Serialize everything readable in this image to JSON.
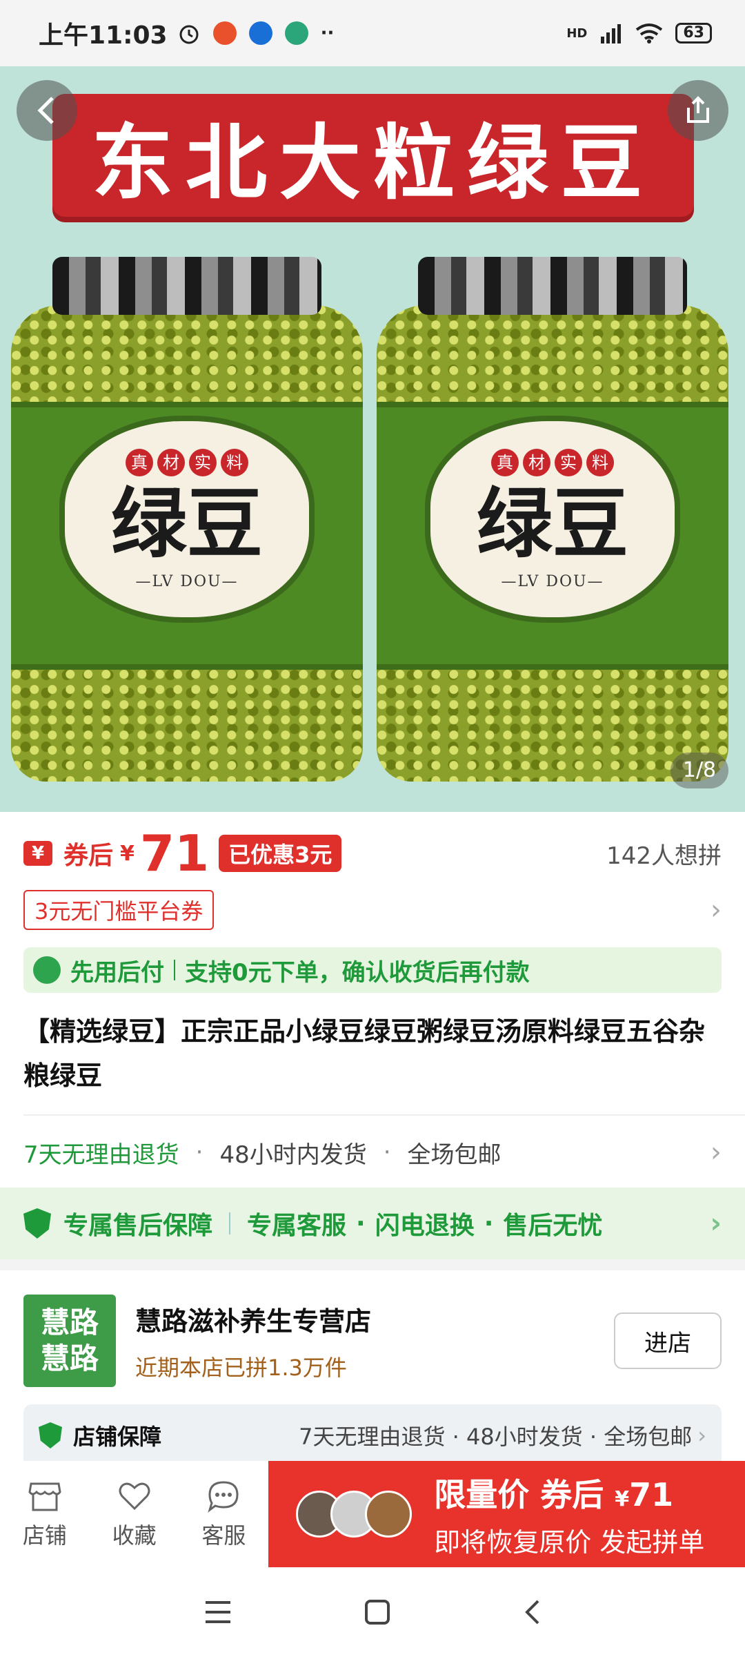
{
  "status_bar": {
    "time": "上午11:03",
    "net_tag": "HD",
    "battery": "63"
  },
  "hero": {
    "banner_text": "东北大粒绿豆",
    "jar_badge": [
      "真",
      "材",
      "实",
      "料"
    ],
    "jar_title": "绿豆",
    "jar_subtitle": "—LV  DOU—",
    "pager": "1/8"
  },
  "price": {
    "coupon_icon": "¥",
    "after_coupon_label": "券后",
    "currency": "¥",
    "amount": "71",
    "discount_badge": "已优惠3元",
    "wants": "142人想拼"
  },
  "coupon": {
    "tag": "3元无门槛平台券"
  },
  "pay_later": {
    "title": "先用后付",
    "detail": "支持0元下单，确认收货后再付款"
  },
  "product": {
    "title": "【精选绿豆】正宗正品小绿豆绿豆粥绿豆汤原料绿豆五谷杂粮绿豆"
  },
  "services": {
    "return": "7天无理由退货",
    "ship": "48小时内发货",
    "free_ship": "全场包邮"
  },
  "after_sale": {
    "title": "专属售后保障",
    "items": [
      "专属客服",
      "闪电退换",
      "售后无忧"
    ]
  },
  "shop": {
    "logo_line1": "慧路",
    "logo_line2": "慧路",
    "name": "慧路滋补养生专营店",
    "sold": "近期本店已拼1.3万件",
    "enter": "进店",
    "guard_title": "店铺保障",
    "guard_items": "7天无理由退货 · 48小时发货 · 全场包邮"
  },
  "action_bar": {
    "shop": "店铺",
    "favorite": "收藏",
    "service": "客服",
    "buy_line1_a": "限量价 券后",
    "buy_currency": "¥",
    "buy_amount": "71",
    "buy_line2": "即将恢复原价 发起拼单"
  },
  "colors": {
    "brand_red": "#e0302c",
    "green": "#1f9a3a",
    "hero_bg": "#bfe3d8"
  }
}
